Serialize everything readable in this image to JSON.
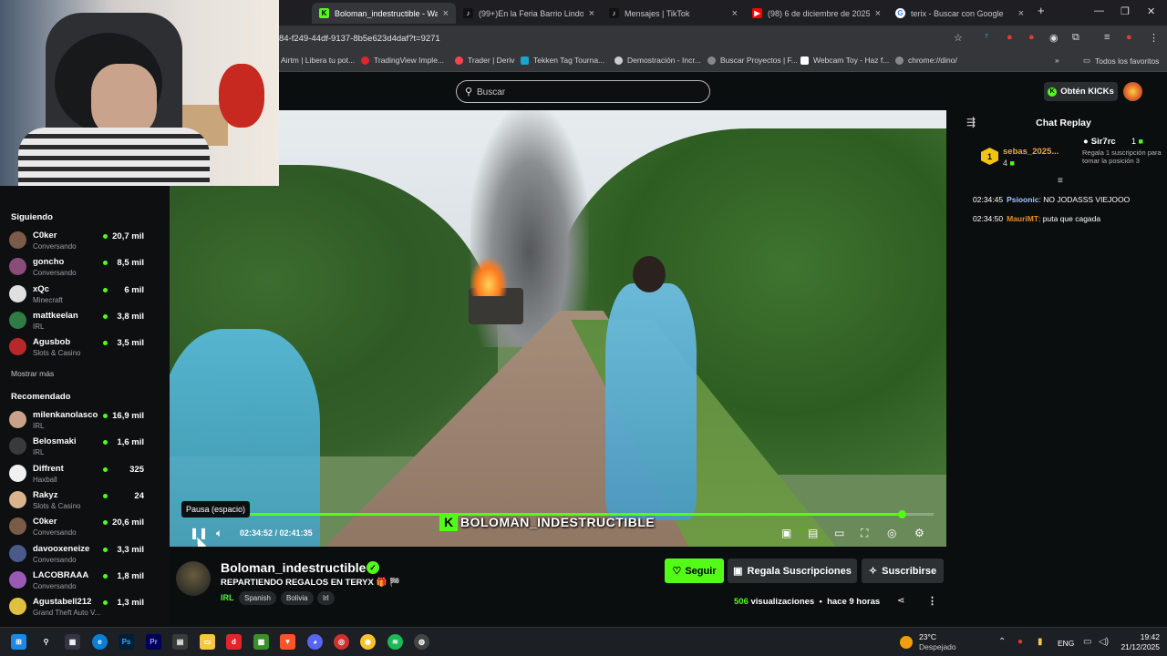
{
  "browser": {
    "tabs": [
      {
        "label": "Boloman_indestructible - Watc",
        "icon_color": "#53fc18",
        "icon": "kick-icon",
        "active": true
      },
      {
        "label": "(99+)En la Feria Barrio Lindo de",
        "icon_color": "#111111",
        "icon": "tiktok-icon"
      },
      {
        "label": "Mensajes | TikTok",
        "icon_color": "#111111",
        "icon": "tiktok-icon"
      },
      {
        "label": "(98) 6 de diciembre de 2025 - V",
        "icon_color": "#ff0000",
        "icon": "youtube-icon"
      },
      {
        "label": "terix - Buscar con Google",
        "icon_color": "#4285f4",
        "icon": "google-icon"
      }
    ],
    "new_tab": "+",
    "url": "84-f249-44df-9137-8b5e623d4daf?t=9271",
    "bookmarks": [
      {
        "label": "Airtm | Libera tu pot...",
        "color": "#2d6cdf"
      },
      {
        "label": "TradingView Imple...",
        "color": "#e0252b"
      },
      {
        "label": "Trader | Deriv",
        "color": "#ff444f"
      },
      {
        "label": "Tekken Tag Tourna...",
        "color": "#1aa6c9"
      },
      {
        "label": "Demostración - Incr...",
        "color": "#cccccc"
      },
      {
        "label": "Buscar Proyectos | F...",
        "color": "#888888"
      },
      {
        "label": "Webcam Toy - Haz f...",
        "color": "#ffffff"
      },
      {
        "label": "chrome://dino/",
        "color": "#888888"
      }
    ],
    "all_bookmarks": "Todos los favoritos"
  },
  "header": {
    "search_placeholder": "Buscar",
    "kicks_button": "Obtén KICKs"
  },
  "sidebar": {
    "following_title": "Siguiendo",
    "following": [
      {
        "name": "C0ker",
        "category": "Conversando",
        "viewers": "20,7 mil",
        "color": "#7a5b48"
      },
      {
        "name": "goncho",
        "category": "Conversando",
        "viewers": "8,5 mil",
        "color": "#8a4d7a"
      },
      {
        "name": "xQc",
        "category": "Minecraft",
        "viewers": "6 mil",
        "color": "#e0e0e0"
      },
      {
        "name": "mattkeelan",
        "category": "IRL",
        "viewers": "3,8 mil",
        "color": "#2f7d44"
      },
      {
        "name": "Agusbob",
        "category": "Slots & Casino",
        "viewers": "3,5 mil",
        "color": "#b8282a"
      }
    ],
    "show_more": "Mostrar más",
    "recommended_title": "Recomendado",
    "recommended": [
      {
        "name": "milenkanolasco",
        "category": "IRL",
        "viewers": "16,9 mil",
        "color": "#c9a289"
      },
      {
        "name": "Belosmaki",
        "category": "IRL",
        "viewers": "1,6 mil",
        "color": "#3a3a3a"
      },
      {
        "name": "Diffrent",
        "category": "Haxball",
        "viewers": "325",
        "color": "#f0f0f0"
      },
      {
        "name": "Rakyz",
        "category": "Slots & Casino",
        "viewers": "24",
        "color": "#d9b38c"
      },
      {
        "name": "C0ker",
        "category": "Conversando",
        "viewers": "20,6 mil",
        "color": "#7a5b48"
      },
      {
        "name": "davooxeneize",
        "category": "Conversando",
        "viewers": "3,3 mil",
        "color": "#4a5a8a"
      },
      {
        "name": "LACOBRAAA",
        "category": "Conversando",
        "viewers": "1,8 mil",
        "color": "#9b59b6"
      },
      {
        "name": "Agustabell212",
        "category": "Grand Theft Auto V...",
        "viewers": "1,3 mil",
        "color": "#e0c040"
      }
    ]
  },
  "video": {
    "watermark": "BOLOMAN_INDESTRUCTIBLE",
    "tooltip": "Pausa (espacio)",
    "current_time": "02:34:52",
    "duration": "02:41:35",
    "progress": 0.958
  },
  "chat": {
    "title": "Chat Replay",
    "top_gifter": {
      "rank": "1",
      "name": "sebas_2025...",
      "count": "4"
    },
    "subscriber": {
      "name": "Sir7rc",
      "count": "1",
      "desc": "Regala 1 suscripción para tomar la posición 3"
    },
    "messages": [
      {
        "time": "02:34:45",
        "user": "Psioonic",
        "color": "#a3c8ff",
        "text": "NO JODASSS VIEJOOO"
      },
      {
        "time": "02:34:50",
        "user": "MauriMT",
        "color": "#f08a24",
        "text": "puta que cagada"
      }
    ]
  },
  "stream_info": {
    "name": "Boloman_indestructible",
    "title": "REPARTIENDO REGALOS EN TERYX 🎁 🏁",
    "category": "IRL",
    "tags": [
      "Spanish",
      "Bolivia",
      "Irl"
    ],
    "follow_button": "Seguir",
    "gift_button": "Regala Suscripciones",
    "subscribe_button": "Suscribirse",
    "views_count": "506",
    "views_label": "visualizaciones",
    "posted": "hace 9 horas"
  },
  "taskbar": {
    "weather_temp": "23°C",
    "weather_desc": "Despejado",
    "language": "ENG",
    "time": "19:42",
    "date": "21/12/2025"
  }
}
